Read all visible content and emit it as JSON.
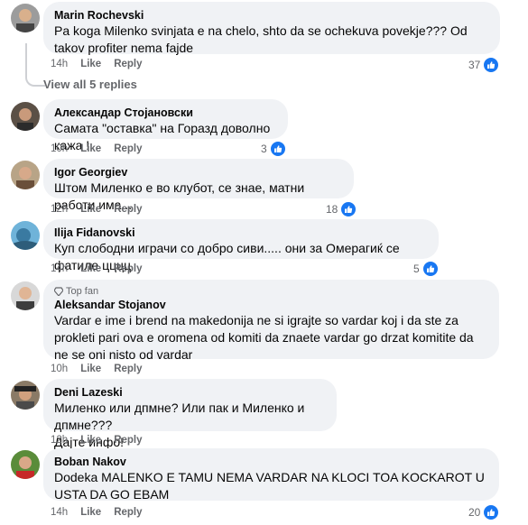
{
  "comments": [
    {
      "author": "Marin Rochevski",
      "text": "Pa koga Milenko svinjata e na chelo, shto da se ochekuva povekje??? Od takov profiter nema fajde",
      "time": "14h",
      "like": "Like",
      "reply": "Reply",
      "reactions": "37"
    },
    {
      "author": "Александар Стојановски",
      "text": "Самата \"оставка\" на Горазд доволно кажа !",
      "time": "10h",
      "like": "Like",
      "reply": "Reply",
      "reactions": "3"
    },
    {
      "author": "Igor Georgiev",
      "text": "Штом Миленко е во клубот, се знае, матни работи има...",
      "time": "12h",
      "like": "Like",
      "reply": "Reply",
      "reactions": "18"
    },
    {
      "author": "Ilija Fidanovski",
      "text": "Куп слободни играчи со добро сиви..... они за Омерагиќ се фатиле цццц",
      "time": "14h",
      "like": "Like",
      "reply": "Reply",
      "reactions": "5"
    },
    {
      "badge": "Top fan",
      "author": "Aleksandar Stojanov",
      "text": "Vardar e ime i brend na makedonija ne si igrajte so vardar koj i da ste za prokleti pari ova e oromena od komiti da znaete vardar go drzat komitite da ne se oni nisto od vardar",
      "time": "10h",
      "like": "Like",
      "reply": "Reply"
    },
    {
      "author": "Deni Lazeski",
      "text": "Миленко или дпмне? Или пак и Миленко и дпмне???\nДајте инфо!",
      "time": "12h",
      "like": "Like",
      "reply": "Reply"
    },
    {
      "author": "Boban Nakov",
      "text": "Dodeka MALENKO E TAMU NEMA VARDAR NA KLOCI TOA KOCKAROT U USTA DA GO EBAM",
      "time": "14h",
      "like": "Like",
      "reply": "Reply",
      "reactions": "20"
    }
  ],
  "view_replies": "View all 5 replies",
  "icons": {
    "like": "thumbs-up-icon",
    "reply_arrow": "reply-arrow-icon",
    "top_fan": "diamond-icon"
  },
  "colors": {
    "like_blue": "#1877f2",
    "bubble": "#f0f2f5",
    "meta": "#65676b"
  }
}
